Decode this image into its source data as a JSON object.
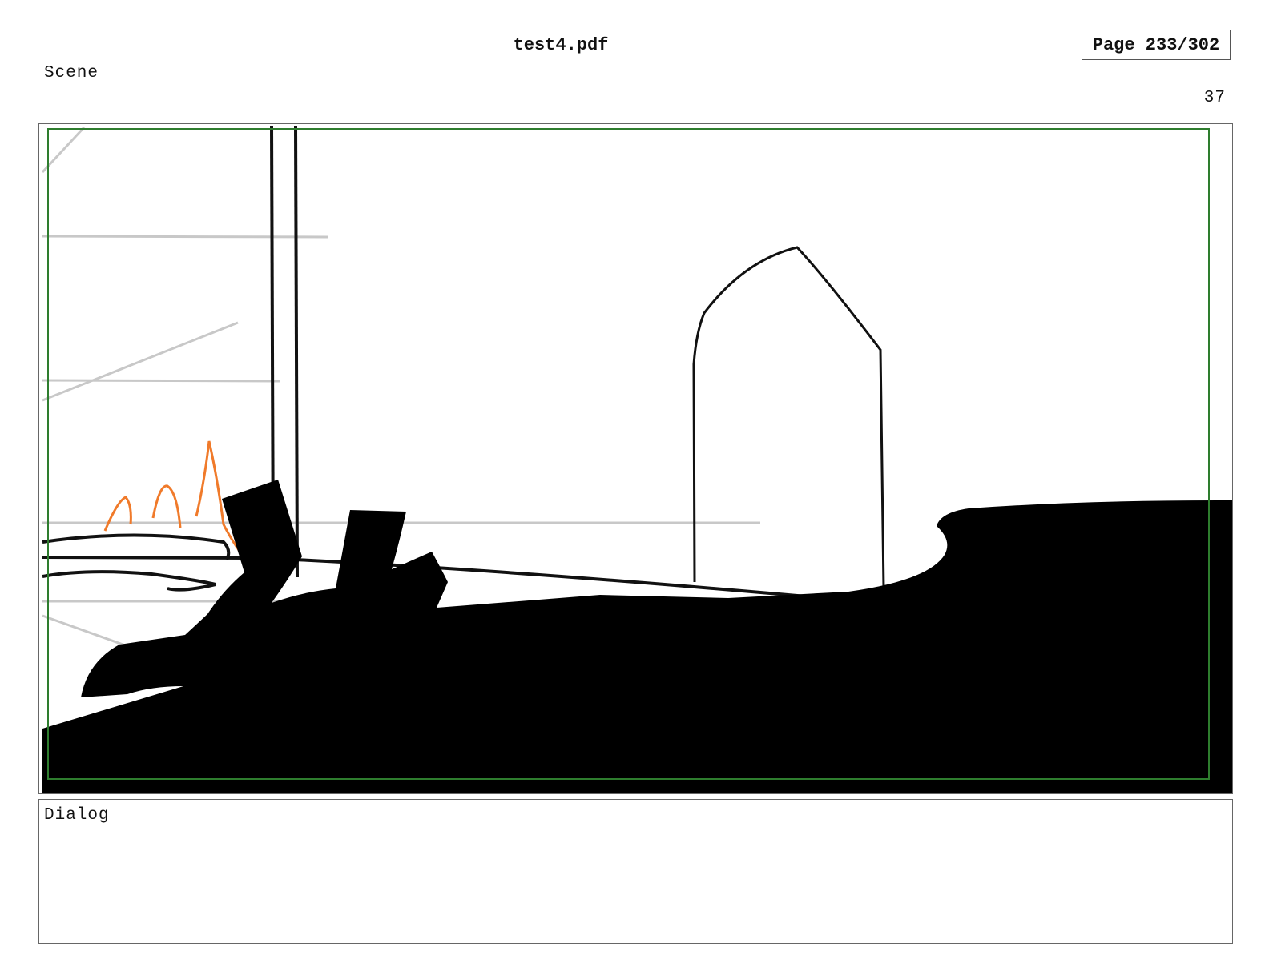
{
  "header": {
    "file_name": "test4.pdf",
    "page_indicator": "Page 233/302"
  },
  "scene": {
    "label": "Scene",
    "number": "37"
  },
  "dialog": {
    "label": "Dialog",
    "text": ""
  },
  "colors": {
    "safe_frame": "#2e7d2e",
    "ink": "#000000",
    "construction_lines": "#c8c8c8",
    "flame_strokes": "#f07a2a"
  }
}
